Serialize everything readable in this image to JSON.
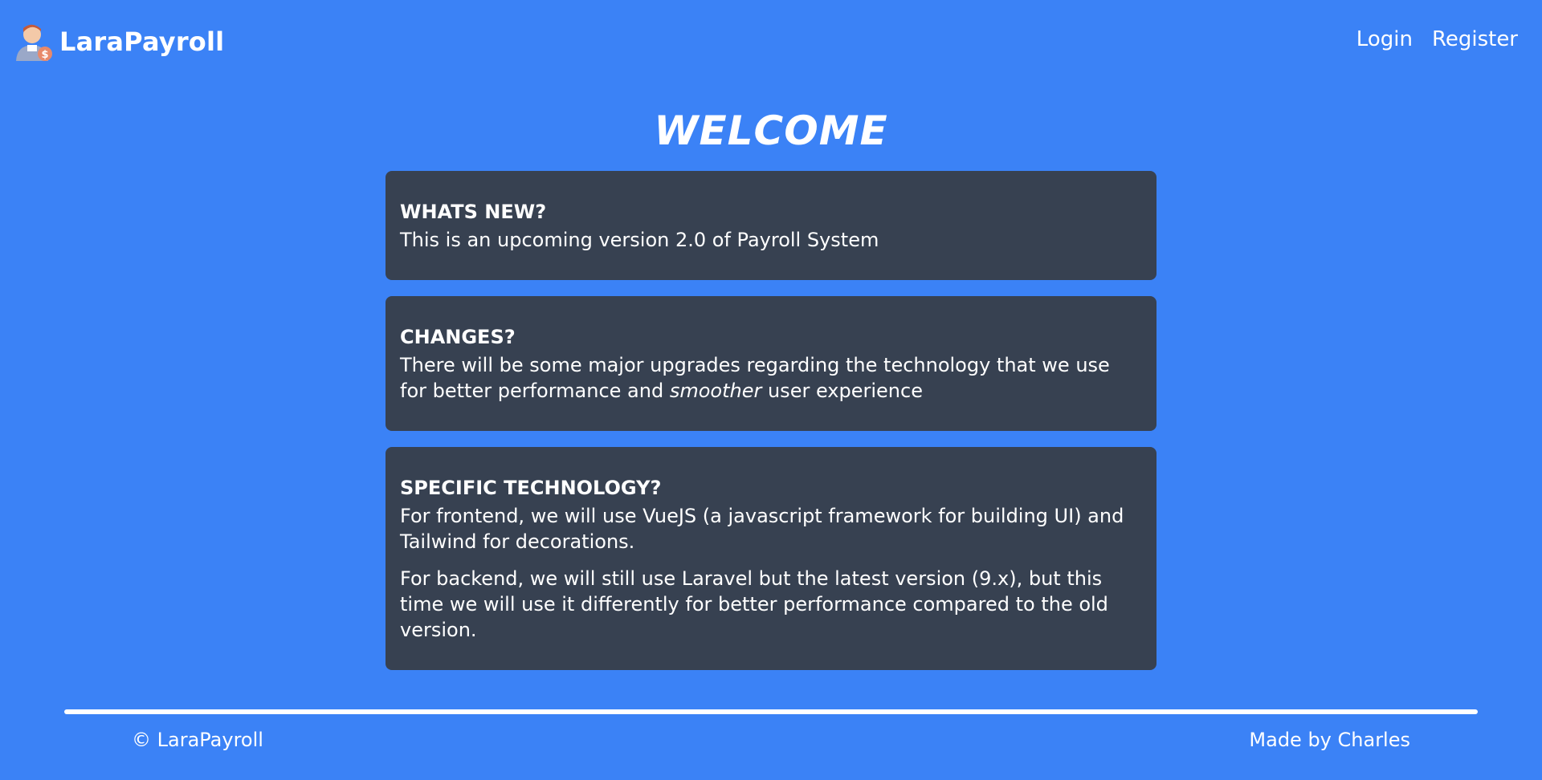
{
  "header": {
    "brand_name": "LaraPayroll",
    "logo_icon": "payroll-user-icon",
    "nav": [
      {
        "label": "Login"
      },
      {
        "label": "Register"
      }
    ]
  },
  "main": {
    "title": "WELCOME",
    "cards": [
      {
        "heading": "WHATS NEW?",
        "paragraphs": [
          "This is an upcoming version 2.0 of Payroll System"
        ]
      },
      {
        "heading": "CHANGES?",
        "paragraph_parts": {
          "before": "There will be some major upgrades regarding the technology that we use for better performance and ",
          "emphasis": "smoother",
          "after": " user experience"
        }
      },
      {
        "heading": "SPECIFIC TECHNOLOGY?",
        "paragraphs": [
          "For frontend, we will use VueJS (a javascript framework for building UI) and Tailwind for decorations.",
          "For backend, we will still use Laravel but the latest version (9.x), but this time we will use it differently for better performance compared to the old version."
        ]
      }
    ]
  },
  "footer": {
    "copyright": "© LaraPayroll",
    "credit": "Made by Charles"
  },
  "colors": {
    "background": "#3b82f6",
    "card": "#374151",
    "text": "#ffffff"
  }
}
